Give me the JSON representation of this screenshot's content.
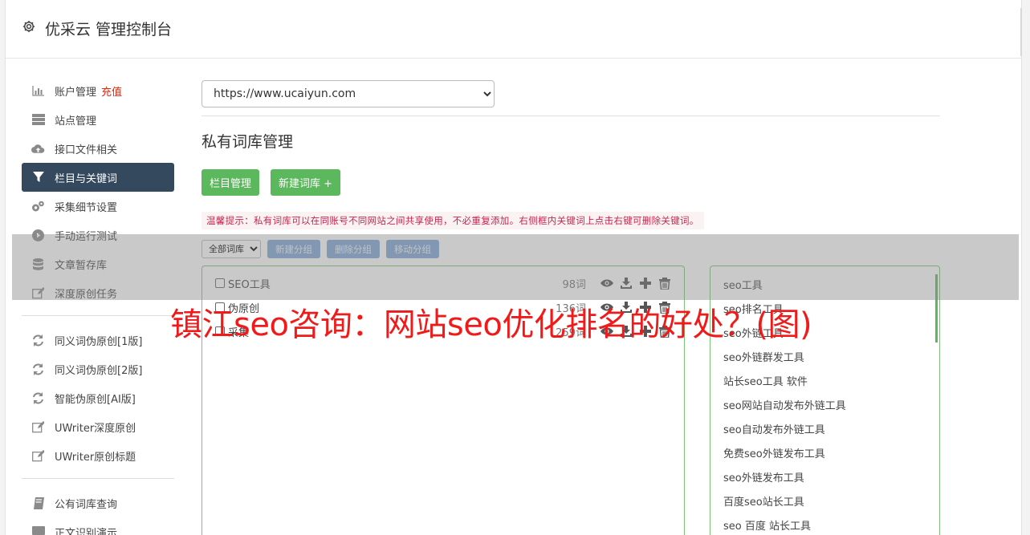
{
  "app": {
    "title": "优采云 管理控制台"
  },
  "sidebar": {
    "items": [
      {
        "label": "账户管理",
        "badge": "充值",
        "icon": "bar-chart-icon"
      },
      {
        "label": "站点管理",
        "icon": "server-icon"
      },
      {
        "label": "接口文件相关",
        "icon": "cloud-upload-icon"
      },
      {
        "label": "栏目与关键词",
        "icon": "filter-icon"
      },
      {
        "label": "采集细节设置",
        "icon": "cogs-icon"
      },
      {
        "label": "手动运行测试",
        "icon": "play-icon"
      },
      {
        "label": "文章暂存库",
        "icon": "database-icon"
      },
      {
        "label": "深度原创任务",
        "icon": "edit-icon"
      }
    ],
    "items2": [
      {
        "label": "同义词伪原创[1版]",
        "icon": "refresh-icon"
      },
      {
        "label": "同义词伪原创[2版]",
        "icon": "refresh-icon"
      },
      {
        "label": "智能伪原创[AI版]",
        "icon": "refresh-icon"
      },
      {
        "label": "UWriter深度原创",
        "icon": "edit-icon"
      },
      {
        "label": "UWriter原创标题",
        "icon": "edit-icon"
      }
    ],
    "items3": [
      {
        "label": "公有词库查询",
        "icon": "book-icon"
      },
      {
        "label": "正文识别演示",
        "icon": "monitor-icon"
      }
    ]
  },
  "main": {
    "site_select": "https://www.ucaiyun.com",
    "section_title": "私有词库管理",
    "buttons": {
      "columns": "栏目管理",
      "new_lib": "新建词库 +"
    },
    "tip": "温馨提示：私有词库可以在同账号不同网站之间共享使用，不必重复添加。右侧框内关键词上点击右键可删除关键词。",
    "group_select": "全部词库",
    "group_buttons": {
      "new": "新建分组",
      "delete": "删除分组",
      "move": "移动分组"
    },
    "libraries": [
      {
        "name": "SEO工具",
        "count": "98词"
      },
      {
        "name": "伪原创",
        "count": "136词"
      },
      {
        "name": "采集",
        "count": "259词"
      }
    ],
    "keywords": [
      "seo工具",
      "seo排名工具",
      "seo外链工具",
      "seo外链群发工具",
      "站长seo工具 软件",
      "seo网站自动发布外链工具",
      "seo自动发布外链工具",
      "免费seo外链发布工具",
      "seo外链发布工具",
      "百度seo站长工具",
      "seo 百度 站长工具"
    ]
  },
  "overlay": {
    "headline": "镇江seo咨询：网站seo优化排名的好处？(图)"
  },
  "colors": {
    "accent_green": "#5cb85c",
    "active_nav": "#34495e",
    "headline_red": "#f01a1a",
    "tip_text": "#c7254e"
  }
}
